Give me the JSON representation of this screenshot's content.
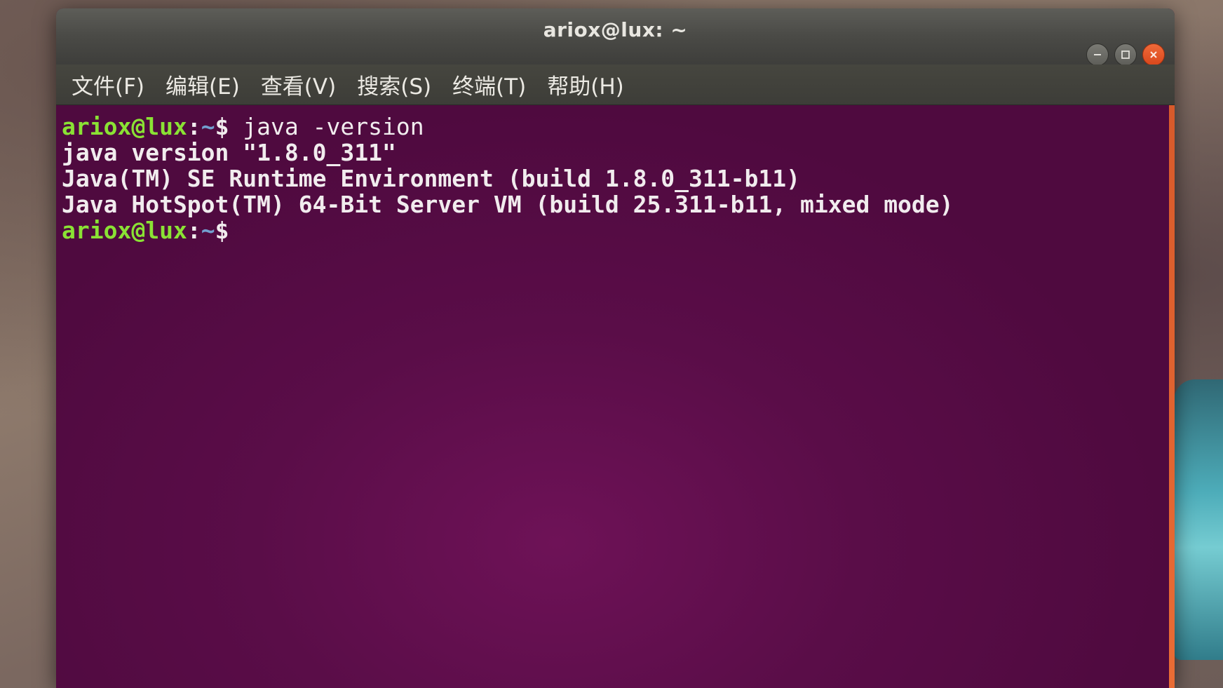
{
  "window": {
    "title": "ariox@lux: ~",
    "controls": {
      "minimize": "minimize-icon",
      "maximize": "maximize-icon",
      "close": "close-icon"
    }
  },
  "menubar": {
    "items": [
      {
        "label": "文件(F)"
      },
      {
        "label": "编辑(E)"
      },
      {
        "label": "查看(V)"
      },
      {
        "label": "搜索(S)"
      },
      {
        "label": "终端(T)"
      },
      {
        "label": "帮助(H)"
      }
    ]
  },
  "terminal": {
    "prompt": {
      "user_host": "ariox@lux",
      "colon": ":",
      "path": "~",
      "symbol": "$"
    },
    "command": " java -version",
    "output": [
      "java version \"1.8.0_311\"",
      "Java(TM) SE Runtime Environment (build 1.8.0_311-b11)",
      "Java HotSpot(TM) 64-Bit Server VM (build 25.311-b11, mixed mode)"
    ]
  },
  "colors": {
    "terminal_bg": "#4f0a3f",
    "prompt_user": "#8ae234",
    "prompt_path": "#729fcf",
    "close_button": "#e5541f"
  }
}
